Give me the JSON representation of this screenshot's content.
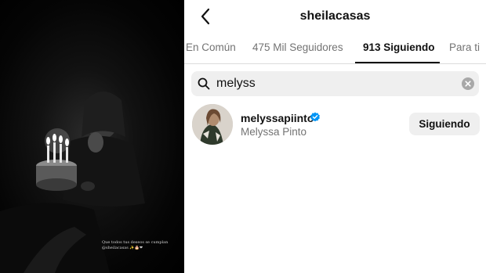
{
  "story": {
    "caption_line1": "Que todos tus deseos se cumplan",
    "caption_line2": "@sheilacasas ✨🎂❤"
  },
  "header": {
    "username": "sheilacasas",
    "back_icon": "chevron-left-icon"
  },
  "tabs": [
    {
      "label": "En Común",
      "active": false
    },
    {
      "label": "475 Mil Seguidores",
      "active": false
    },
    {
      "label": "913 Siguiendo",
      "active": true
    },
    {
      "label": "Para ti",
      "active": false
    }
  ],
  "search": {
    "value": "melyss",
    "icon": "search-icon",
    "clear_icon": "clear-icon"
  },
  "results": [
    {
      "handle": "melyssapiinto",
      "verified": true,
      "full_name": "Melyssa Pinto",
      "button_label": "Siguiendo"
    }
  ],
  "colors": {
    "verified": "#0095f6",
    "muted_text": "#737373",
    "button_bg": "#efefef"
  }
}
